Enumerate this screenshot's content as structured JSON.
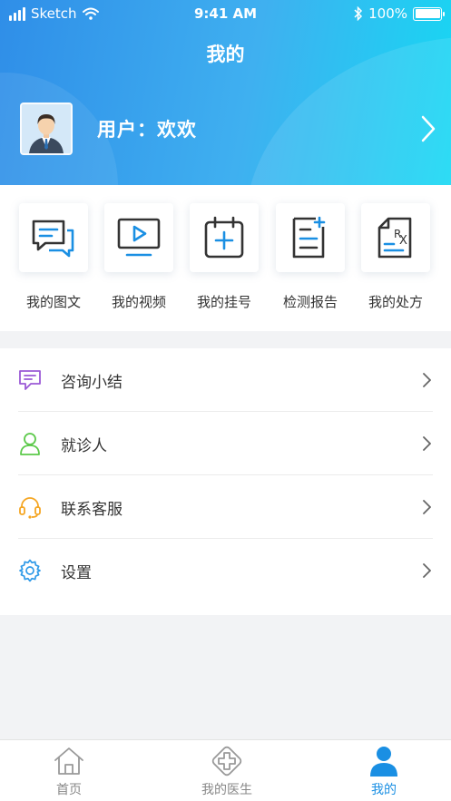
{
  "status_bar": {
    "carrier": "Sketch",
    "time": "9:41 AM",
    "battery": "100%"
  },
  "header": {
    "title": "我的",
    "username": "用户：欢欢"
  },
  "quick_actions": [
    {
      "label": "我的图文",
      "icon": "chat-bubbles-icon"
    },
    {
      "label": "我的视频",
      "icon": "video-play-icon"
    },
    {
      "label": "我的挂号",
      "icon": "calendar-plus-icon"
    },
    {
      "label": "检测报告",
      "icon": "report-icon"
    },
    {
      "label": "我的处方",
      "icon": "prescription-icon"
    }
  ],
  "menu": [
    {
      "label": "咨询小结",
      "icon": "message-icon",
      "color": "#9b59d6"
    },
    {
      "label": "就诊人",
      "icon": "person-icon",
      "color": "#5cc94a"
    },
    {
      "label": "联系客服",
      "icon": "headset-icon",
      "color": "#f5a623"
    },
    {
      "label": "设置",
      "icon": "gear-icon",
      "color": "#2f9ae8"
    }
  ],
  "tabbar": [
    {
      "label": "首页",
      "active": false
    },
    {
      "label": "我的医生",
      "active": false
    },
    {
      "label": "我的",
      "active": true
    }
  ],
  "colors": {
    "accent": "#1a8fe3",
    "header_start": "#2f8ee8",
    "header_end": "#16d8f3"
  }
}
